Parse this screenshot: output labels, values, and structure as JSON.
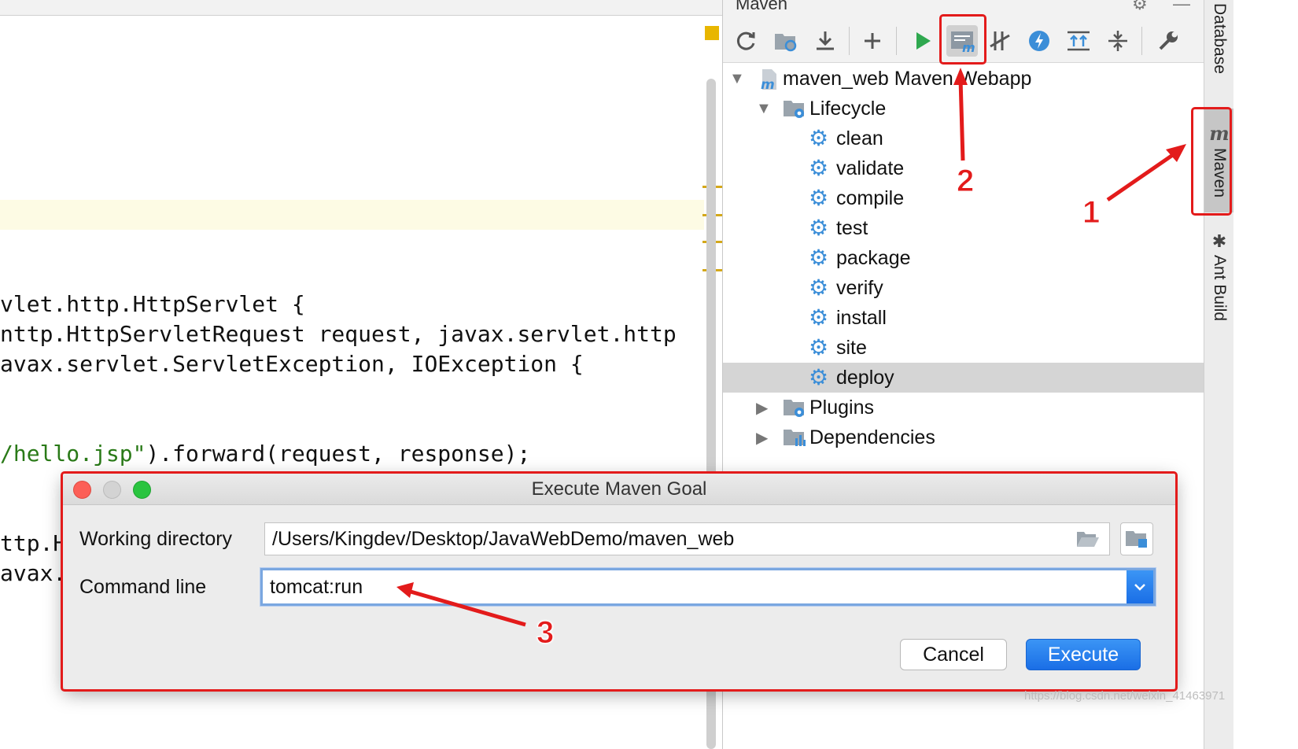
{
  "editor": {
    "code_lines": [
      {
        "text": "vlet.http.HttpServlet {"
      },
      {
        "text": "nttp.HttpServletRequest request, javax.servlet.http"
      },
      {
        "text": "avax.servlet.ServletException, IOException {"
      },
      {
        "pre": "",
        "str": "/hello.jsp\"",
        "post": ").forward(request, response);"
      },
      {
        "text": "ttp.H"
      },
      {
        "text": "avax."
      }
    ]
  },
  "maven_panel": {
    "title": "Maven",
    "toolbar": {
      "buttons": [
        {
          "name": "reload-icon"
        },
        {
          "name": "generate-sources-icon"
        },
        {
          "name": "download-icon"
        },
        {
          "name": "add-icon"
        },
        {
          "name": "run-icon"
        },
        {
          "name": "execute-maven-goal-icon"
        },
        {
          "name": "skip-tests-icon"
        },
        {
          "name": "offline-mode-icon"
        },
        {
          "name": "show-dependencies-icon"
        },
        {
          "name": "collapse-all-icon"
        },
        {
          "name": "settings-icon"
        }
      ]
    },
    "tree": {
      "project": "maven_web Maven Webapp",
      "lifecycle_label": "Lifecycle",
      "lifecycle": [
        "clean",
        "validate",
        "compile",
        "test",
        "package",
        "verify",
        "install",
        "site",
        "deploy"
      ],
      "selected_goal": "deploy",
      "plugins_label": "Plugins",
      "dependencies_label": "Dependencies"
    }
  },
  "tool_strip": {
    "tabs": [
      "Database",
      "Maven",
      "Ant Build"
    ],
    "maven_glyph": "m"
  },
  "dialog": {
    "title": "Execute Maven Goal",
    "working_directory_label": "Working directory",
    "working_directory_value": "/Users/Kingdev/Desktop/JavaWebDemo/maven_web",
    "command_line_label": "Command line",
    "command_line_value": "tomcat:run",
    "cancel_label": "Cancel",
    "execute_label": "Execute"
  },
  "annotations": {
    "callouts": [
      "1",
      "2",
      "3"
    ],
    "color": "#e31b1b"
  },
  "colors": {
    "accent_blue": "#1a6ee6",
    "gear_blue": "#3b8ed8",
    "string_green": "#2a7a18"
  },
  "watermark": "https://blog.csdn.net/weixin_41463971"
}
